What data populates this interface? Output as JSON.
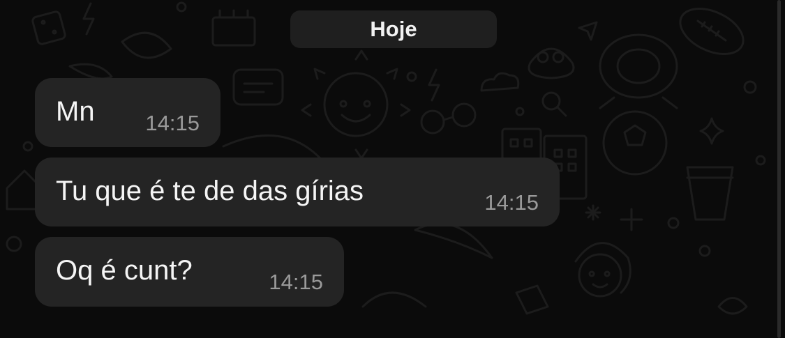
{
  "chat": {
    "date_separator": "Hoje",
    "messages": [
      {
        "text": "Mn",
        "time": "14:15"
      },
      {
        "text": "Tu que é te de das gírias",
        "time": "14:15"
      },
      {
        "text": "Oq é cunt?",
        "time": "14:15"
      }
    ]
  },
  "colors": {
    "background": "#0b0b0b",
    "bubble": "#242424",
    "date_pill": "#1f1f1f",
    "message_text": "#f5f5f5",
    "timestamp_text": "#9a9a9a",
    "doodle_stroke": "#1c1c1c"
  }
}
